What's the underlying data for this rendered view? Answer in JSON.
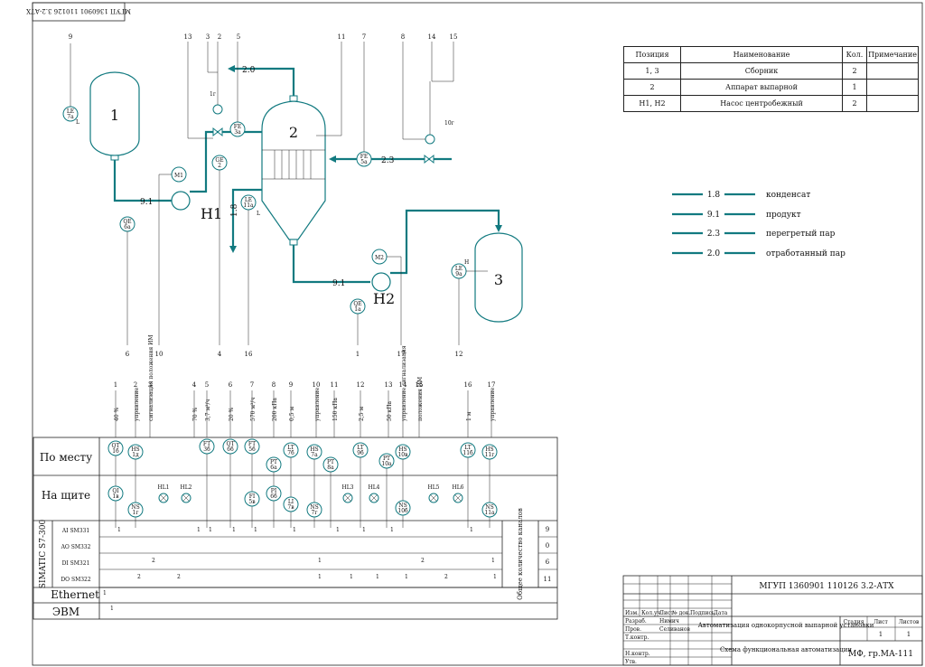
{
  "stamp_top": "МГУП 1360901 110126 3.2-АТХ",
  "spec_table": {
    "headers": [
      "Позиция",
      "Наименование",
      "Кол.",
      "Примечание"
    ],
    "rows": [
      [
        "1, 3",
        "Сборник",
        "2",
        ""
      ],
      [
        "2",
        "Аппарат выпарной",
        "1",
        ""
      ],
      [
        "Н1, Н2",
        "Насос центробежный",
        "2",
        ""
      ]
    ]
  },
  "legend": [
    {
      "code": "1.8",
      "label": "конденсат"
    },
    {
      "code": "9.1",
      "label": "продукт"
    },
    {
      "code": "2.3",
      "label": "перегретый пар"
    },
    {
      "code": "2.0",
      "label": "отработанный пар"
    }
  ],
  "equipment": {
    "v1": "1",
    "v2": "2",
    "v3": "3",
    "h1": "Н1",
    "h2": "Н2"
  },
  "pipe_labels": {
    "p20": "2.0",
    "p23": "2.3",
    "p91a": "9.1",
    "p91b": "9.1",
    "p18": "1.8"
  },
  "top_numbers": [
    "9",
    "13",
    "3",
    "2",
    "5",
    "11",
    "7",
    "8",
    "14",
    "15"
  ],
  "bottom_numbers": [
    "6",
    "10",
    "4",
    "16",
    "1",
    "17",
    "12"
  ],
  "devices": {
    "le7a": [
      "LE",
      "7а"
    ],
    "fe3a": [
      "FE",
      "3а"
    ],
    "ge2": [
      "GE",
      "2"
    ],
    "m1": [
      "M1",
      ""
    ],
    "qe6a": [
      "QE",
      "6а"
    ],
    "le11a": [
      "LE",
      "11а"
    ],
    "fe5a": [
      "FE",
      "5а"
    ],
    "m2": [
      "M2",
      ""
    ],
    "qe1a": [
      "QE",
      "1а"
    ],
    "le9a": [
      "LE",
      "9а"
    ],
    "v1r": [
      "1г",
      ""
    ],
    "v10r": [
      "10г",
      ""
    ]
  },
  "marks": {
    "L1": "L",
    "L2": "L",
    "H": "Н"
  },
  "loop_cols": [
    {
      "n": "1",
      "desc": "40 %"
    },
    {
      "n": "2",
      "desc": "управление"
    },
    {
      "n": "3",
      "desc": "сигнализация положения ИМ"
    },
    {
      "n": "4",
      "desc": "70 %"
    },
    {
      "n": "5",
      "desc": "3,7 м³/ч"
    },
    {
      "n": "6",
      "desc": "20 %"
    },
    {
      "n": "7",
      "desc": "570 м³/ч"
    },
    {
      "n": "8",
      "desc": "200 кПа"
    },
    {
      "n": "9",
      "desc": "0,5 м"
    },
    {
      "n": "10",
      "desc": "управление"
    },
    {
      "n": "11",
      "desc": "150 кПа"
    },
    {
      "n": "12",
      "desc": "2,5 м"
    },
    {
      "n": "13",
      "desc": "50 кПа"
    },
    {
      "n": "14",
      "desc": "управление сигнализация"
    },
    {
      "n": "15",
      "desc": "положения ИМ"
    },
    {
      "n": "16",
      "desc": "1 м"
    },
    {
      "n": "17",
      "desc": "управление"
    }
  ],
  "grid": {
    "row_local": "По месту",
    "row_panel": "На щите",
    "simatic": "SIMATIC S7-300",
    "modules": [
      "AI SM331",
      "AO SM332",
      "DI SM321",
      "DO SM322"
    ],
    "ethernet": "Ethernet",
    "evm": "ЭВМ",
    "total_label": "Общее количество каналов",
    "totals": [
      "9",
      "0",
      "6",
      "11"
    ]
  },
  "local_devices": [
    [
      "QT",
      "1б"
    ],
    [
      "HS",
      "1д"
    ],
    [
      "FT",
      "3б"
    ],
    [
      "QT",
      "6б"
    ],
    [
      "FT",
      "5б"
    ],
    [
      "PT",
      "6а"
    ],
    [
      "LT",
      "7б"
    ],
    [
      "HS",
      "7а"
    ],
    [
      "PT",
      "8а"
    ],
    [
      "LT",
      "9б"
    ],
    [
      "PT",
      "10а"
    ],
    [
      "HS",
      "10в"
    ],
    [
      "LT",
      "11б"
    ],
    [
      "HS",
      "11г"
    ]
  ],
  "panel_devices": [
    [
      "QI",
      "1в"
    ],
    [
      "NS",
      "1г"
    ],
    [
      "FI",
      "5в"
    ],
    [
      "PI",
      "6б"
    ],
    [
      "LI",
      "7в"
    ],
    [
      "NS",
      "7г"
    ],
    [
      "NS",
      "10б"
    ],
    [
      "NS",
      "11а"
    ]
  ],
  "lamps": [
    "HL1",
    "HL2",
    "HL3",
    "HL4",
    "HL5",
    "HL6"
  ],
  "channel_marks": [
    "1",
    "1",
    "1",
    "1",
    "1",
    "1",
    "1",
    "1",
    "1",
    "2",
    "2",
    "1",
    "1",
    "2",
    "1",
    "1",
    "2",
    "1",
    "1",
    "1",
    "2",
    "1",
    "1",
    "1"
  ],
  "title_block": {
    "code": "МГУП 1360901 110126 3.2-АТХ",
    "project": "Автоматизация однокорпусной выпарной установки",
    "sheet_name": "Схема функциональная автоматизации",
    "stage": "Стадия",
    "sheet": "Лист",
    "sheets": "Листов",
    "sheet_no": "1",
    "sheets_no": "1",
    "org": "МФ, гр.МА-111",
    "roles": [
      "Разраб.",
      "Пров.",
      "Т.контр.",
      "",
      "Н.контр.",
      "Утв."
    ],
    "names": [
      "Нимич",
      "Селиванов"
    ],
    "cols": [
      "Изм.",
      "Кол.уч.",
      "Лист",
      "№ док.",
      "Подпись",
      "Дата"
    ]
  }
}
